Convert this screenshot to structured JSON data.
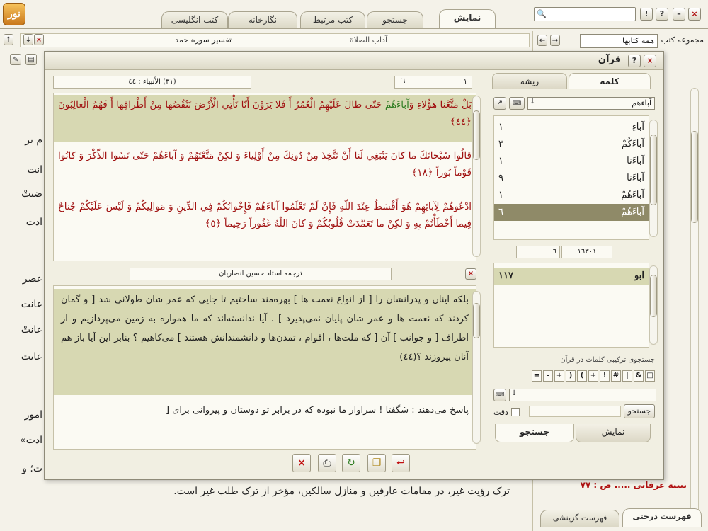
{
  "app": {
    "logo_text": "نور"
  },
  "tabs": [
    {
      "label": "نمایش",
      "active": true
    },
    {
      "label": "جستجو",
      "active": false
    },
    {
      "label": "کتب مرتبط",
      "active": false
    },
    {
      "label": "نگارخانه",
      "active": false
    },
    {
      "label": "کتب انگلیسی",
      "active": false
    }
  ],
  "window_buttons": {
    "help": "?",
    "info": "!",
    "minimize": "–",
    "close": "×"
  },
  "doc_toolbar": {
    "right_title": "تفسیر سوره حمد",
    "left_title": "آداب الصلاة",
    "collection_label": "مجموعه کتب",
    "collection_value": "همه کتابها"
  },
  "background_text": {
    "lines": [
      "م بر",
      "انت",
      "ضيتْ",
      "ادت",
      "عصر",
      "عانت",
      "عانتْ",
      "عانت",
      "امور",
      "ادت»",
      "ت؛ و"
    ],
    "bottom_line": "ترک رؤیت غیر، در مقامات عارفین و منازل سالکین، مؤخر از ترک طلب غیر است.",
    "tree_item": "تنبیه عرفانی ..... ص : ۷۷",
    "bottom_tabs": [
      "فهرست درختی",
      "فهرست گزینشی"
    ]
  },
  "dialog": {
    "title": "قرآن",
    "buttons": {
      "close": "×",
      "help": "?",
      "info": "!"
    },
    "verse_ref": "(۳۱) الأنبیاء : ٤٤",
    "field_one": "١",
    "field_six": "٦",
    "verses": [
      {
        "parts": [
          {
            "text": "بَلْ مَتَّعْنا هؤُلاءِ وَ",
            "style": "red"
          },
          {
            "text": "آباءَهُمْ",
            "style": "green"
          },
          {
            "text": " حَتّى طالَ عَلَيْهِمُ الْعُمُرُ أَ فَلا يَرَوْنَ أَنّا نَأْتِي الْأَرْضَ نَنْقُصُها مِنْ أَطْرافِها أَ فَهُمُ الْغالِبُونَ ﴿٤٤﴾",
            "style": "red"
          }
        ],
        "highlight": true
      },
      {
        "parts": [
          {
            "text": "قالُوا سُبْحانَكَ ما كانَ يَنْبَغِي لَنا أَنْ نَتَّخِذَ مِنْ دُونِكَ مِنْ أَوْلِياءَ وَ لكِنْ مَتَّعْتَهُمْ وَ آباءَهُمْ حَتّى نَسُوا الذِّكْرَ وَ كانُوا قَوْماً بُوراً ﴿١٨﴾",
            "style": "red"
          }
        ],
        "highlight": false
      },
      {
        "parts": [
          {
            "text": "ادْعُوهُمْ لِآبائِهِمْ هُوَ أَقْسَطُ عِنْدَ اللّهِ فَإِنْ لَمْ تَعْلَمُوا آباءَهُمْ فَإِخْوانُكُمْ فِي الدِّينِ وَ مَوالِيكُمْ وَ لَيْسَ عَلَيْكُمْ جُناحٌ فِيما أَخْطَأْتُمْ بِهِ وَ لكِنْ ما تَعَمَّدَتْ قُلُوبُكُمْ وَ كانَ اللّهُ غَفُوراً رَحِيماً ﴿٥﴾",
            "style": "red"
          }
        ],
        "highlight": false
      }
    ],
    "translator": "ترجمه استاد حسین انصاریان",
    "translation_highlighted": "بلکه اینان و پدرانشان را [ از انواع نعمت ها ] بهره‌مند ساختیم تا جایی که عمر شان طولانی شد [ و گمان کردند که نعمت ها و عمر شان پایان نمی‌پذیرد ] . آیا ندانسته‌اند که ما همواره به زمین می‌پردازیم و از اطراف [ و جوانب ] آن [ که ملت‌ها ، اقوام ، تمدن‌ها و دانشمندانش هستند ] می‌کاهیم ؟ بنابر این آیا باز هم آنان پیروزند ؟(٤٤)",
    "translation_next": "پاسخ می‌دهند : شگفتا ! سزاوار ما نبوده که در برابر تو دوستان و پیروانی برای [",
    "side": {
      "tabs": [
        {
          "label": "کلمه",
          "active": true
        },
        {
          "label": "ریشه",
          "active": false
        }
      ],
      "word_input": "آباءهم",
      "words": [
        {
          "word": "آباءِ",
          "count": "١"
        },
        {
          "word": "آباءَكُمْ",
          "count": "٣"
        },
        {
          "word": "آباءَنا",
          "count": "١"
        },
        {
          "word": "آباءَنا",
          "count": "٩"
        },
        {
          "word": "آباءَهُمْ",
          "count": "١"
        },
        {
          "word": "آباءَهُمْ",
          "count": "٦",
          "selected": true
        }
      ],
      "total_left": "٦",
      "total_right": "١٦٣٠١",
      "root_result": {
        "word": "ابو",
        "count": "١١٧"
      },
      "compound_label": "جستجوی ترکیبی کلمات در قرآن",
      "operators": [
        "□",
        "&",
        "|",
        "#",
        "!",
        "+",
        "(",
        ")",
        "+",
        "-",
        "="
      ],
      "exact_label": "دقت",
      "search_button": "جستجو",
      "bottom_tabs": [
        {
          "label": "نمایش",
          "active": false
        },
        {
          "label": "جستجو",
          "active": true
        }
      ]
    },
    "toolbar_icons": [
      "close-red",
      "print",
      "refresh",
      "copy",
      "exit"
    ]
  },
  "colors": {
    "highlight": "#d7d8b2",
    "selected_row": "#8f8a68",
    "verse_red": "#a01010",
    "verse_green": "#2f7d22"
  }
}
